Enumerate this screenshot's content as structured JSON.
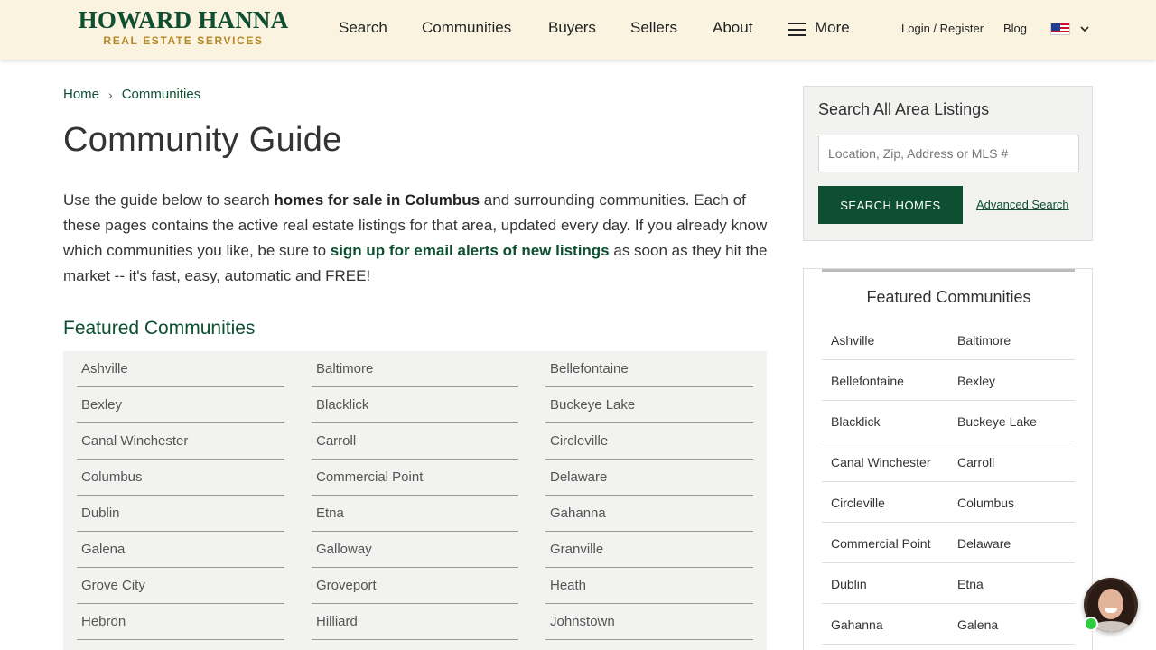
{
  "header": {
    "logo_main": "HOWARD HANNA",
    "logo_sub": "REAL ESTATE SERVICES",
    "nav": [
      "Search",
      "Communities",
      "Buyers",
      "Sellers",
      "About"
    ],
    "more_label": "More",
    "login_label": "Login / Register",
    "blog_label": "Blog",
    "flag_icon": "us-flag-icon"
  },
  "breadcrumb": {
    "home": "Home",
    "current": "Communities"
  },
  "page_title": "Community Guide",
  "intro": {
    "p1": "Use the guide below to search ",
    "link1": "homes for sale in Columbus",
    "p2": " and surrounding communities. Each of these pages contains the active real estate listings for that area, updated every day. If you already know which communities you like, be sure to ",
    "link2": "sign up for email alerts of new listings",
    "p3": " as soon as they hit the market -- it's fast, easy, automatic and FREE!"
  },
  "featured": {
    "heading": "Featured Communities",
    "columns": [
      [
        "Ashville",
        "Bexley",
        "Canal Winchester",
        "Columbus",
        "Dublin",
        "Galena",
        "Grove City",
        "Hebron"
      ],
      [
        "Baltimore",
        "Blacklick",
        "Carroll",
        "Commercial Point",
        "Etna",
        "Galloway",
        "Groveport",
        "Hilliard"
      ],
      [
        "Bellefontaine",
        "Buckeye Lake",
        "Circleville",
        "Delaware",
        "Gahanna",
        "Granville",
        "Heath",
        "Johnstown"
      ]
    ]
  },
  "search_panel": {
    "title": "Search All Area Listings",
    "placeholder": "Location, Zip, Address or MLS #",
    "button": "SEARCH HOMES",
    "advanced": "Advanced Search"
  },
  "side_featured": {
    "title": "Featured Communities",
    "rows": [
      [
        "Ashville",
        "Baltimore"
      ],
      [
        "Bellefontaine",
        "Bexley"
      ],
      [
        "Blacklick",
        "Buckeye Lake"
      ],
      [
        "Canal Winchester",
        "Carroll"
      ],
      [
        "Circleville",
        "Columbus"
      ],
      [
        "Commercial Point",
        "Delaware"
      ],
      [
        "Dublin",
        "Etna"
      ],
      [
        "Gahanna",
        "Galena"
      ]
    ]
  },
  "colors": {
    "brand_green": "#0e4f32",
    "brand_gold": "#b8872a",
    "header_bg": "#f9f3df"
  }
}
